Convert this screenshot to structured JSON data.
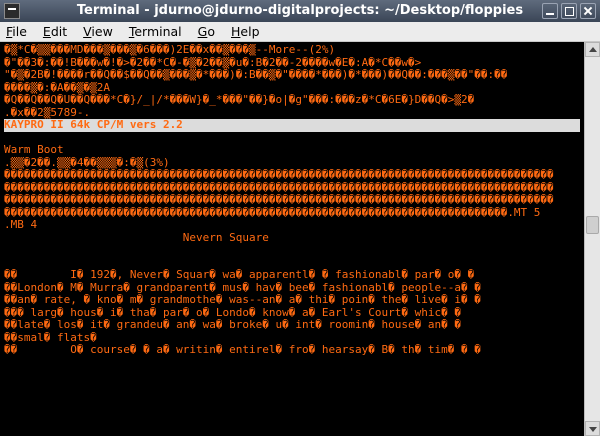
{
  "window": {
    "title": "Terminal - jdurno@jdurno-digitalprojects: ~/Desktop/floppies"
  },
  "menu": [
    {
      "label": "File",
      "mnemonic": "F",
      "rest": "ile"
    },
    {
      "label": "Edit",
      "mnemonic": "E",
      "rest": "dit"
    },
    {
      "label": "View",
      "mnemonic": "V",
      "rest": "iew"
    },
    {
      "label": "Terminal",
      "mnemonic": "T",
      "rest": "erminal"
    },
    {
      "label": "Go",
      "mnemonic": "G",
      "rest": "o"
    },
    {
      "label": "Help",
      "mnemonic": "H",
      "rest": "elp"
    }
  ],
  "terminal": {
    "lines": [
      "�▒*C�▒▒���MD���▒���▒�6���)2E��x��▒���▒--More--(2%)",
      "�\"��3�:��!B���w�!�>�2��*C�-�▒�2��▒�u�:B�2��-2����w�E�:A�*C��w�>",
      "\"�▒�2B�!����r��Q��$��Q��▒���▒�*���)�:B��▒�\"����*���)�*���)��Q��:���▒��\"��:��",
      "����▒�:�A��▒�▒2A",
      "�Q��Q��Q�U��Q���*C�}/_|/*���W}�_*���\"��}�o|�g\"���:���z�*C�6E�}D��Q�>▒2�",
      ".�x��2▒5789-.",
      "KAYPRO II 64k CP/M vers 2.2",
      "",
      "Warm Boot",
      ".▒▒�2��.▒▒�4��▒▒▒�:�▒(3%)",
      "�����������������������������������������������������������������������������������",
      "�����������������������������������������������������������������������������������",
      "�����������������������������������������������������������������������������������",
      "����������������������������������������������������������������������������.MT 5",
      ".MB 4",
      "                           Nevern Square",
      "",
      "",
      "��        I� 192�, Never� Squar� wa� apparentl� � fashionabl� par� o� �",
      "��London� M� Murra� grandparent� mus� hav� bee� fashionabl� people--a� �",
      "��an� rate, � kno� m� grandmothe� was--an� a� thi� poin� the� live� i� �",
      "��� larg� hous� i� tha� par� o� Londo� know� a� Earl's Court� whic� �",
      "��late� los� it� grandeu� an� wa� broke� u� int� roomin� house� an� �",
      "��smal� flats�",
      "��        O� course� � a� writin� entirel� fro� hearsay� B� th� tim� � �"
    ],
    "highlight_index": 6
  },
  "scrollbar": {
    "position_fraction": 0.46,
    "thumb_fraction": 0.05
  }
}
